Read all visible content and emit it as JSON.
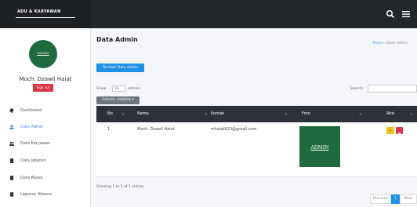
{
  "brand": {
    "name": "ADU & KARYAWAN"
  },
  "user": {
    "avatar_text": "ADMIN",
    "name": "Moch. Dzawil Haiat",
    "signout_label": "Sign out"
  },
  "sidebar": {
    "items": [
      {
        "label": "Dashboard",
        "icon": "palette-icon"
      },
      {
        "label": "Data Admin",
        "icon": "user-icon"
      },
      {
        "label": "Data Karyawan",
        "icon": "users-icon"
      },
      {
        "label": "Data Jabatan",
        "icon": "file-icon"
      },
      {
        "label": "Data Absen",
        "icon": "book-icon"
      },
      {
        "label": "Laporan Absens",
        "icon": "book-icon"
      }
    ]
  },
  "header": {
    "title": "Data Admin",
    "breadcrumb_home": "Home",
    "breadcrumb_sep": "/",
    "breadcrumb_current": "Data Admin"
  },
  "toolbar": {
    "add_label": "Tambah Data Admin",
    "show_label": "Show",
    "show_value": "10",
    "entries_label": "entries",
    "search_label": "Search:",
    "colvis_label": "Column visibility"
  },
  "table": {
    "columns": [
      "No",
      "Nama",
      "Kontak",
      "Foto",
      "Aksi"
    ],
    "rows": [
      {
        "no": "1",
        "nama": "Moch. Dzawil Haiat",
        "kontak": "mhaiat823@gmail.com",
        "foto_text": "ADMIN"
      }
    ]
  },
  "footer": {
    "info": "Showing 1 to 1 of 1 entries",
    "prev_label": "Previous",
    "page": "1",
    "next_label": "Next"
  },
  "colors": {
    "topbar": "#23272b",
    "primary": "#1e90e6",
    "danger": "#dc3545",
    "warning": "#f0c419",
    "avatar": "#1f6b3e"
  }
}
